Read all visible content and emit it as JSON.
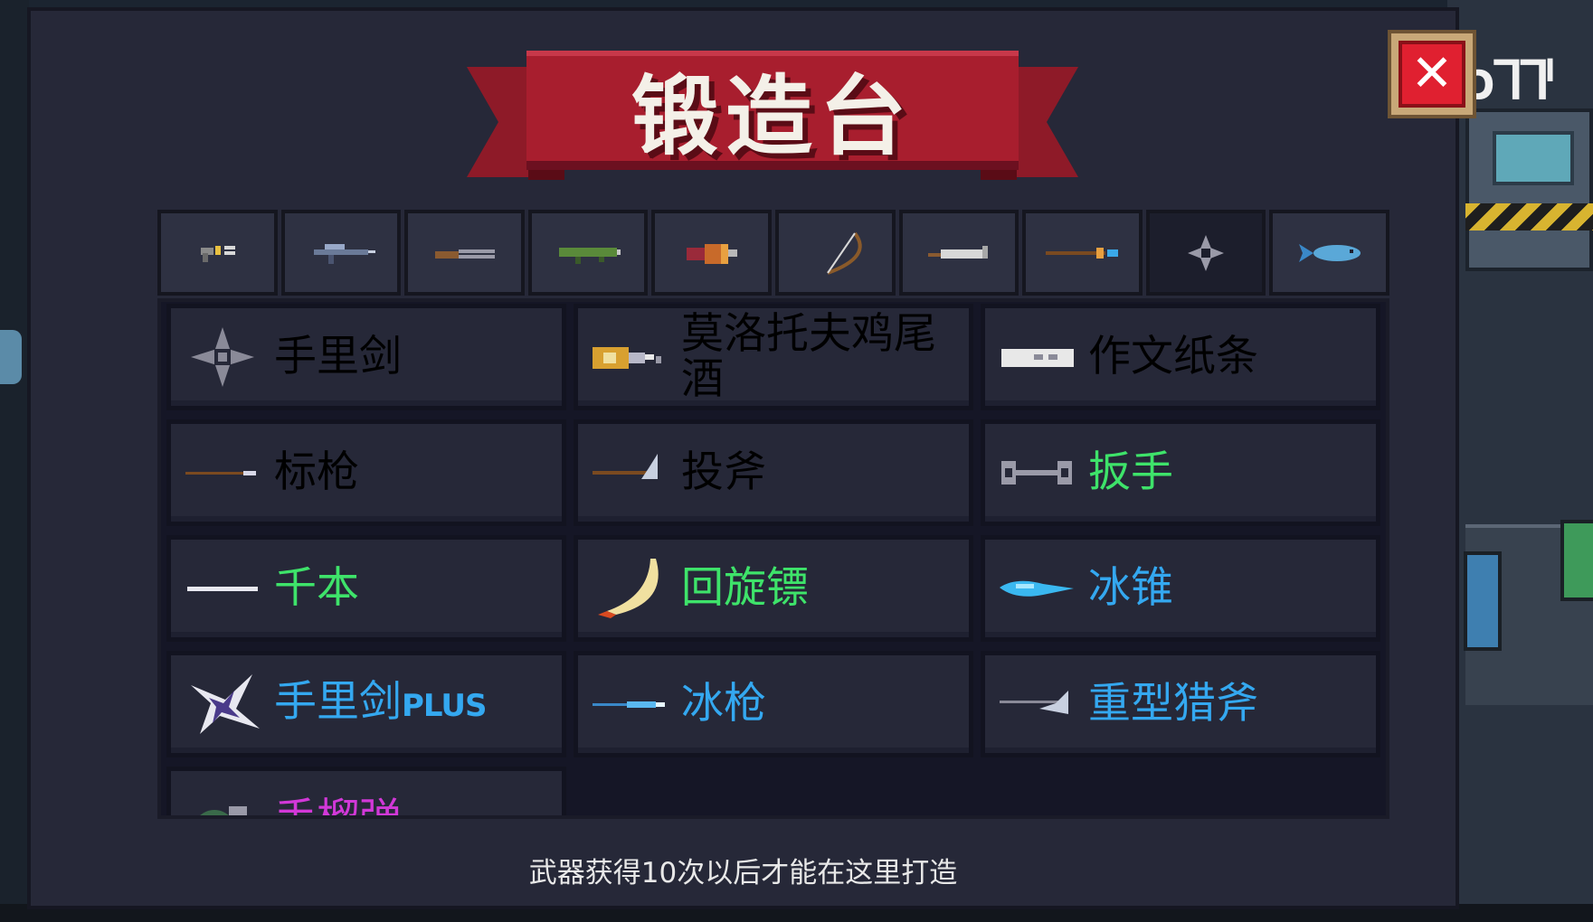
{
  "title": "锻造台",
  "close_button": {
    "label": "✕",
    "icon": "close-icon"
  },
  "tabs": [
    {
      "icon": "pistol-icon",
      "active": false
    },
    {
      "icon": "rifle-icon",
      "active": false
    },
    {
      "icon": "shotgun-icon",
      "active": false
    },
    {
      "icon": "rocket-launcher-icon",
      "active": false
    },
    {
      "icon": "flamethrower-icon",
      "active": false
    },
    {
      "icon": "bow-icon",
      "active": false
    },
    {
      "icon": "sword-icon",
      "active": false
    },
    {
      "icon": "staff-icon",
      "active": false
    },
    {
      "icon": "shuriken-icon",
      "active": true
    },
    {
      "icon": "fish-icon",
      "active": false
    }
  ],
  "weapons": [
    {
      "name": "手里剑",
      "icon": "shuriken-icon",
      "color": "#ececec"
    },
    {
      "name": "莫洛托夫鸡尾酒",
      "icon": "molotov-icon",
      "color": "#ececec"
    },
    {
      "name": "作文纸条",
      "icon": "paper-note-icon",
      "color": "#ececec"
    },
    {
      "name": "标枪",
      "icon": "javelin-icon",
      "color": "#ececec"
    },
    {
      "name": "投斧",
      "icon": "throwing-axe-icon",
      "color": "#ececec"
    },
    {
      "name": "扳手",
      "icon": "wrench-icon",
      "color": "#3ee36a"
    },
    {
      "name": "千本",
      "icon": "senbon-icon",
      "color": "#3ee36a"
    },
    {
      "name": "回旋镖",
      "icon": "boomerang-icon",
      "color": "#3ee36a"
    },
    {
      "name": "冰锥",
      "icon": "ice-cone-icon",
      "color": "#34a8f0"
    },
    {
      "name": "手里剑",
      "name_suffix": "PLUS",
      "icon": "shuriken-plus-icon",
      "color": "#34a8f0"
    },
    {
      "name": "冰枪",
      "icon": "ice-spear-icon",
      "color": "#34a8f0"
    },
    {
      "name": "重型猎斧",
      "icon": "heavy-hunting-axe-icon",
      "color": "#34a8f0"
    },
    {
      "name": "手榴弹",
      "icon": "grenade-icon",
      "color": "#d238d8"
    }
  ],
  "footer_note": "武器获得10次以后才能在这里打造",
  "background_sign": "ɔᒣᒣᑊ"
}
